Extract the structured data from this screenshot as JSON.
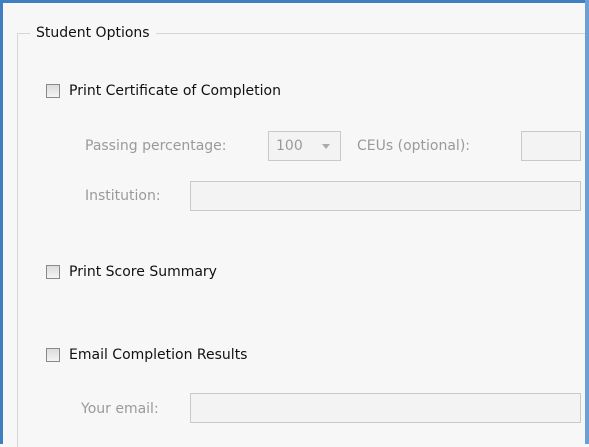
{
  "group": {
    "title": "Student Options"
  },
  "certificate": {
    "checkbox_label": "Print Certificate of Completion",
    "checked": false,
    "passing_label": "Passing percentage:",
    "passing_value": "100",
    "ceus_label": "CEUs (optional):",
    "ceus_value": "",
    "institution_label": "Institution:",
    "institution_value": ""
  },
  "score_summary": {
    "checkbox_label": "Print Score Summary",
    "checked": false
  },
  "email_results": {
    "checkbox_label": "Email Completion Results",
    "checked": false,
    "email_label": "Your email:",
    "email_value": ""
  },
  "colors": {
    "window_border": "#3f7fbf",
    "disabled_text": "#9a9a9a",
    "group_line": "#d6d6d6"
  }
}
